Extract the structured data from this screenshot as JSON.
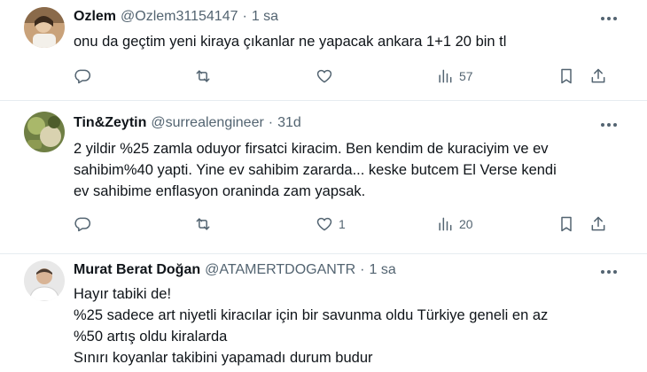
{
  "tweets": [
    {
      "name": "Ozlem",
      "handle": "@Ozlem31154147",
      "separator": "·",
      "time": "1 sa",
      "text_lines": [
        "onu da geçtim yeni kiraya çıkanlar ne yapacak ankara 1+1 20 bin tl"
      ],
      "replies": "",
      "retweets": "",
      "likes": "",
      "views": "57"
    },
    {
      "name": "Tin&Zeytin",
      "handle": "@surrealengineer",
      "separator": "·",
      "time": "31d",
      "text_lines": [
        "2 yildir %25 zamla oduyor firsatci kiracim. Ben kendim de kuraciyim ve ev",
        "sahibim%40 yapti. Yine ev sahibim zararda... keske butcem El Verse kendi",
        "ev sahibime enflasyon oraninda zam yapsak."
      ],
      "replies": "",
      "retweets": "",
      "likes": "1",
      "views": "20"
    },
    {
      "name": "Murat Berat Doğan",
      "handle": "@ATAMERTDOGANTR",
      "separator": "·",
      "time": "1 sa",
      "text_lines": [
        "Hayır tabiki de!",
        "%25 sadece art niyetli kiracılar için bir savunma oldu Türkiye geneli en az",
        "%50 artış oldu kiralarda",
        "Sınırı koyanlar takibini yapamadı durum budur"
      ]
    }
  ],
  "icons": {
    "more": "more-dots-icon",
    "reply": "reply-icon",
    "retweet": "retweet-icon",
    "like": "heart-icon",
    "views": "views-chart-icon",
    "bookmark": "bookmark-icon",
    "share": "share-icon"
  },
  "colors": {
    "text": "#0f1419",
    "secondary": "#536471",
    "divider": "#e6ecf0"
  }
}
